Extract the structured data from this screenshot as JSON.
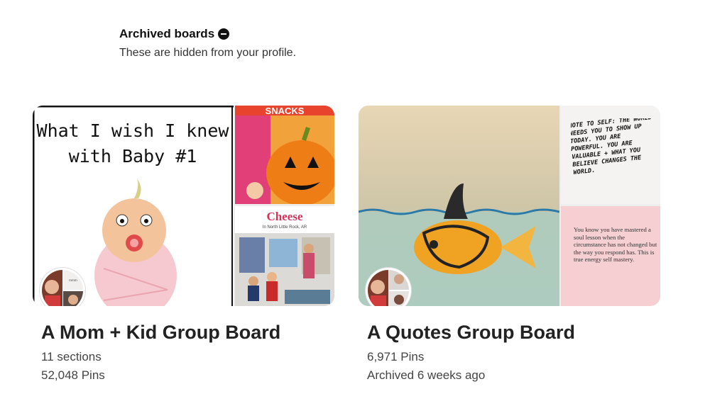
{
  "header": {
    "title": "Archived boards",
    "subtitle": "These are hidden from your profile."
  },
  "boards": [
    {
      "name": "A Mom + Kid Group Board",
      "line1": "11 sections",
      "line2": "52,048 Pins",
      "cover_main_text": "What I wish I knew with Baby #1",
      "side_top_text": "SNACKS",
      "side_bottom_text": "Cheese",
      "side_bottom_subtext": "In North Little Rock, AR"
    },
    {
      "name": "A Quotes Group Board",
      "line1": "6,971 Pins",
      "line2": "Archived 6 weeks ago",
      "side_top_text": "NOTE TO SELF: THE WORLD NEEDS YOU TO SHOW UP TODAY. YOU ARE POWERFUL. YOU ARE VALUABLE + WHAT YOU BELIEVE CHANGES THE WORLD.",
      "side_bottom_text": "You know you have mastered a soul lesson when the circumstance has not changed but the way you respond has. This is true energy self mastery."
    }
  ]
}
